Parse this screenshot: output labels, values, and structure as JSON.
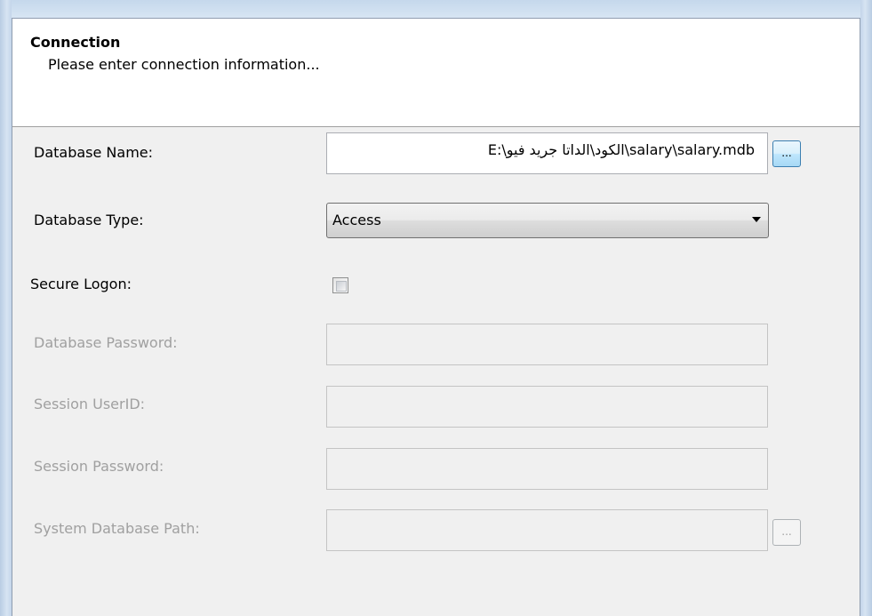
{
  "header": {
    "title": "Connection",
    "subtitle": "Please enter connection information..."
  },
  "form": {
    "database_name": {
      "label": "Database Name:",
      "value": "E:\\الكود\\الداتا جريد فيو\\salary\\salary.mdb",
      "browse_label": "..."
    },
    "database_type": {
      "label": "Database Type:",
      "selected": "Access"
    },
    "secure_logon": {
      "label": "Secure Logon:",
      "checked": false
    },
    "database_password": {
      "label": "Database Password:",
      "value": ""
    },
    "session_userid": {
      "label": "Session UserID:",
      "value": ""
    },
    "session_password": {
      "label": "Session Password:",
      "value": ""
    },
    "system_database_path": {
      "label": "System Database Path:",
      "value": "",
      "browse_label": "..."
    }
  }
}
